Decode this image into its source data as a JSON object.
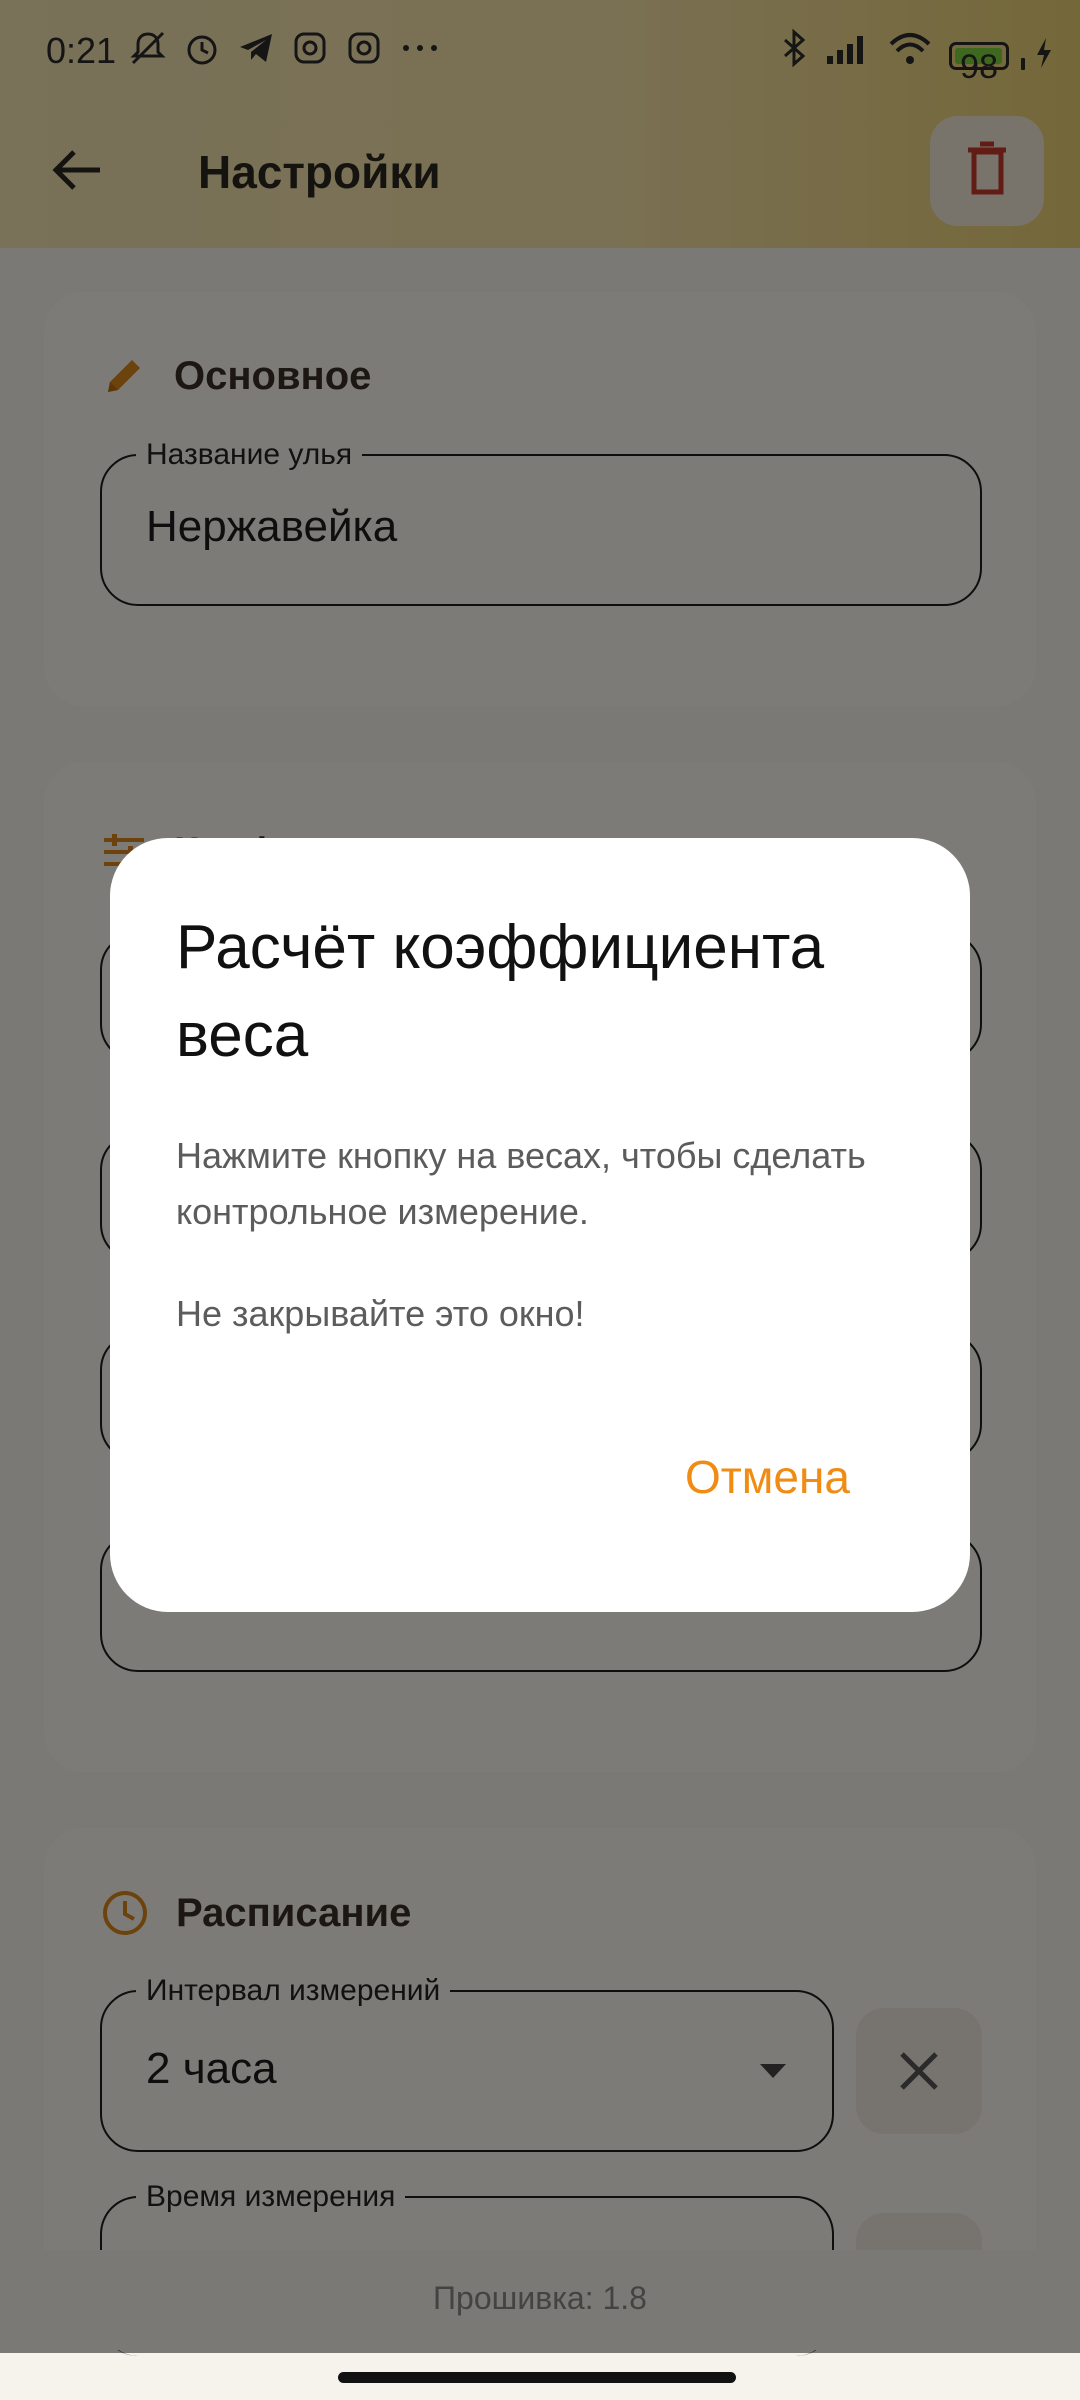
{
  "status_bar": {
    "time": "0:21",
    "left_icons": [
      "notifications-off-icon",
      "alarm-icon",
      "telegram-icon",
      "instagram-icon",
      "instagram-icon",
      "more-icon"
    ],
    "right_icons": [
      "bluetooth-icon",
      "signal-icon",
      "wifi-icon"
    ],
    "battery": 98,
    "battery_text": "98"
  },
  "app_bar": {
    "title": "Настройки"
  },
  "cards": {
    "basic": {
      "title": "Основное",
      "hive_name_label": "Название улья",
      "hive_name_value": "Нержавейка"
    },
    "coefficients": {
      "title": "Коэф..."
    },
    "schedule": {
      "title": "Расписание",
      "interval_label": "Интервал измерений",
      "interval_value": "2 часа",
      "time_label": "Время измерения"
    }
  },
  "footer": {
    "firmware": "Прошивка: 1.8"
  },
  "dialog": {
    "title": "Расчёт коэффициента веса",
    "message": "Нажмите кнопку на весах, чтобы сделать контрольное измерение.",
    "warning": "Не закрывайте это окно!",
    "cancel": "Отмена"
  },
  "colors": {
    "accent": "#f08c14",
    "delete": "#c0392b",
    "header_gradient_start": "#f2e3b0",
    "header_gradient_end": "#e9cf73",
    "battery": "#7bd13a"
  }
}
